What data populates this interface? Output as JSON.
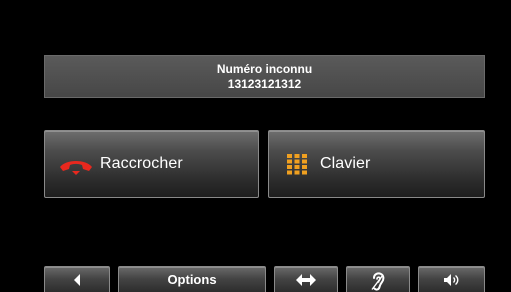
{
  "caller": {
    "name": "Numéro inconnu",
    "number": "13123121312"
  },
  "actions": {
    "hangup_label": "Raccrocher",
    "keypad_label": "Clavier"
  },
  "toolbar": {
    "options_label": "Options",
    "icons": [
      "back-arrow-icon",
      "transfer-arrows-icon",
      "hearing-aid-icon",
      "speaker-icon"
    ]
  },
  "colors": {
    "hangup_icon": "#e8281e",
    "keypad_icon": "#f0a020",
    "background": "#000000",
    "banner": "#4d4d4d"
  }
}
